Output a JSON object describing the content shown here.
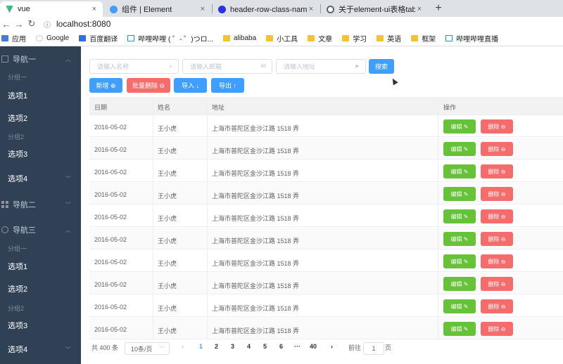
{
  "browser": {
    "tabs": [
      {
        "title": "vue",
        "favicon": "vue-icon"
      },
      {
        "title": "组件 | Element",
        "favicon": "element-icon"
      },
      {
        "title": "header-row-class-name_百度搜",
        "favicon": "baidu-icon"
      },
      {
        "title": "关于element-ui表格table设置h",
        "favicon": "csdn-icon"
      }
    ],
    "new_tab": "+",
    "close": "×",
    "url": "localhost:8080",
    "bookmarks": [
      {
        "label": "应用",
        "icon": "apps-icon"
      },
      {
        "label": "Google",
        "icon": "google-icon"
      },
      {
        "label": "百度翻译",
        "icon": "baidu-translate-icon"
      },
      {
        "label": "哔哩哔哩 ( ゜- ゜)つロ...",
        "icon": "bilibili-icon"
      },
      {
        "label": "alibaba",
        "icon": "folder-icon"
      },
      {
        "label": "小工具",
        "icon": "folder-icon"
      },
      {
        "label": "文章",
        "icon": "folder-icon"
      },
      {
        "label": "学习",
        "icon": "folder-icon"
      },
      {
        "label": "英语",
        "icon": "folder-icon"
      },
      {
        "label": "框架",
        "icon": "folder-icon"
      },
      {
        "label": "哔哩哔哩直播",
        "icon": "bilibili-icon"
      }
    ]
  },
  "sidebar": {
    "nav1": {
      "title": "导航一",
      "group1": "分组一",
      "item1": "选项1",
      "item2": "选项2",
      "group2": "分组2",
      "item3": "选项3",
      "item4": "选项4"
    },
    "nav2": {
      "title": "导航二"
    },
    "nav3": {
      "title": "导航三",
      "group1": "分组一",
      "item1": "选项1",
      "item2": "选项2",
      "group2": "分组2",
      "item3": "选项3",
      "item4": "选项4"
    }
  },
  "search": {
    "name_placeholder": "请输入名称",
    "email_placeholder": "请输入邮箱",
    "address_placeholder": "请输入地址",
    "search_button": "搜索"
  },
  "toolbar": {
    "add": "新增 ⊕",
    "batch_delete": "批量删除 ⊖",
    "import": "导入 ↓",
    "export": "导出 ↑"
  },
  "table": {
    "headers": {
      "date": "日期",
      "name": "姓名",
      "address": "地址",
      "actions": "操作"
    },
    "edit_label": "编辑 ✎",
    "delete_label": "删除 ⊖",
    "rows": [
      {
        "date": "2016-05-02",
        "name": "王小虎",
        "address": "上海市普陀区金沙江路 1518 弄"
      },
      {
        "date": "2016-05-02",
        "name": "王小虎",
        "address": "上海市普陀区金沙江路 1518 弄"
      },
      {
        "date": "2016-05-02",
        "name": "王小虎",
        "address": "上海市普陀区金沙江路 1518 弄"
      },
      {
        "date": "2016-05-02",
        "name": "王小虎",
        "address": "上海市普陀区金沙江路 1518 弄"
      },
      {
        "date": "2016-05-02",
        "name": "王小虎",
        "address": "上海市普陀区金沙江路 1518 弄"
      },
      {
        "date": "2016-05-02",
        "name": "王小虎",
        "address": "上海市普陀区金沙江路 1518 弄"
      },
      {
        "date": "2016-05-02",
        "name": "王小虎",
        "address": "上海市普陀区金沙江路 1518 弄"
      },
      {
        "date": "2016-05-02",
        "name": "王小虎",
        "address": "上海市普陀区金沙江路 1518 弄"
      },
      {
        "date": "2016-05-02",
        "name": "王小虎",
        "address": "上海市普陀区金沙江路 1518 弄"
      },
      {
        "date": "2016-05-02",
        "name": "王小虎",
        "address": "上海市普陀区金沙江路 1518 弄"
      }
    ]
  },
  "pagination": {
    "total": "共 400 条",
    "page_size": "10条/页",
    "prev": "‹",
    "pages": [
      "1",
      "2",
      "3",
      "4",
      "5",
      "6"
    ],
    "ellipsis": "···",
    "last": "40",
    "next": "›",
    "goto_label": "前往",
    "goto_value": "1",
    "goto_suffix": "页",
    "current_page": "1"
  },
  "colors": {
    "sidebar_bg": "#304156",
    "primary": "#409eff",
    "danger": "#f56c6c",
    "success": "#67c23a"
  }
}
